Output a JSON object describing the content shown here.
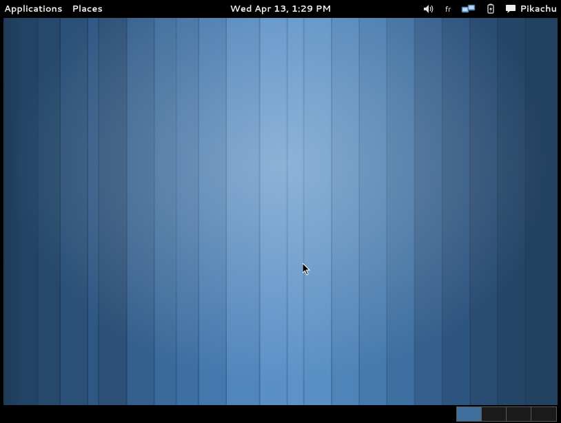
{
  "top_panel": {
    "applications": "Applications",
    "places": "Places",
    "datetime": "Wed Apr 13,  1:29 PM",
    "keyboard_layout": "fr",
    "username": "Pikachu"
  },
  "bottom_panel": {
    "workspace_count": 4,
    "active_workspace": 1
  }
}
